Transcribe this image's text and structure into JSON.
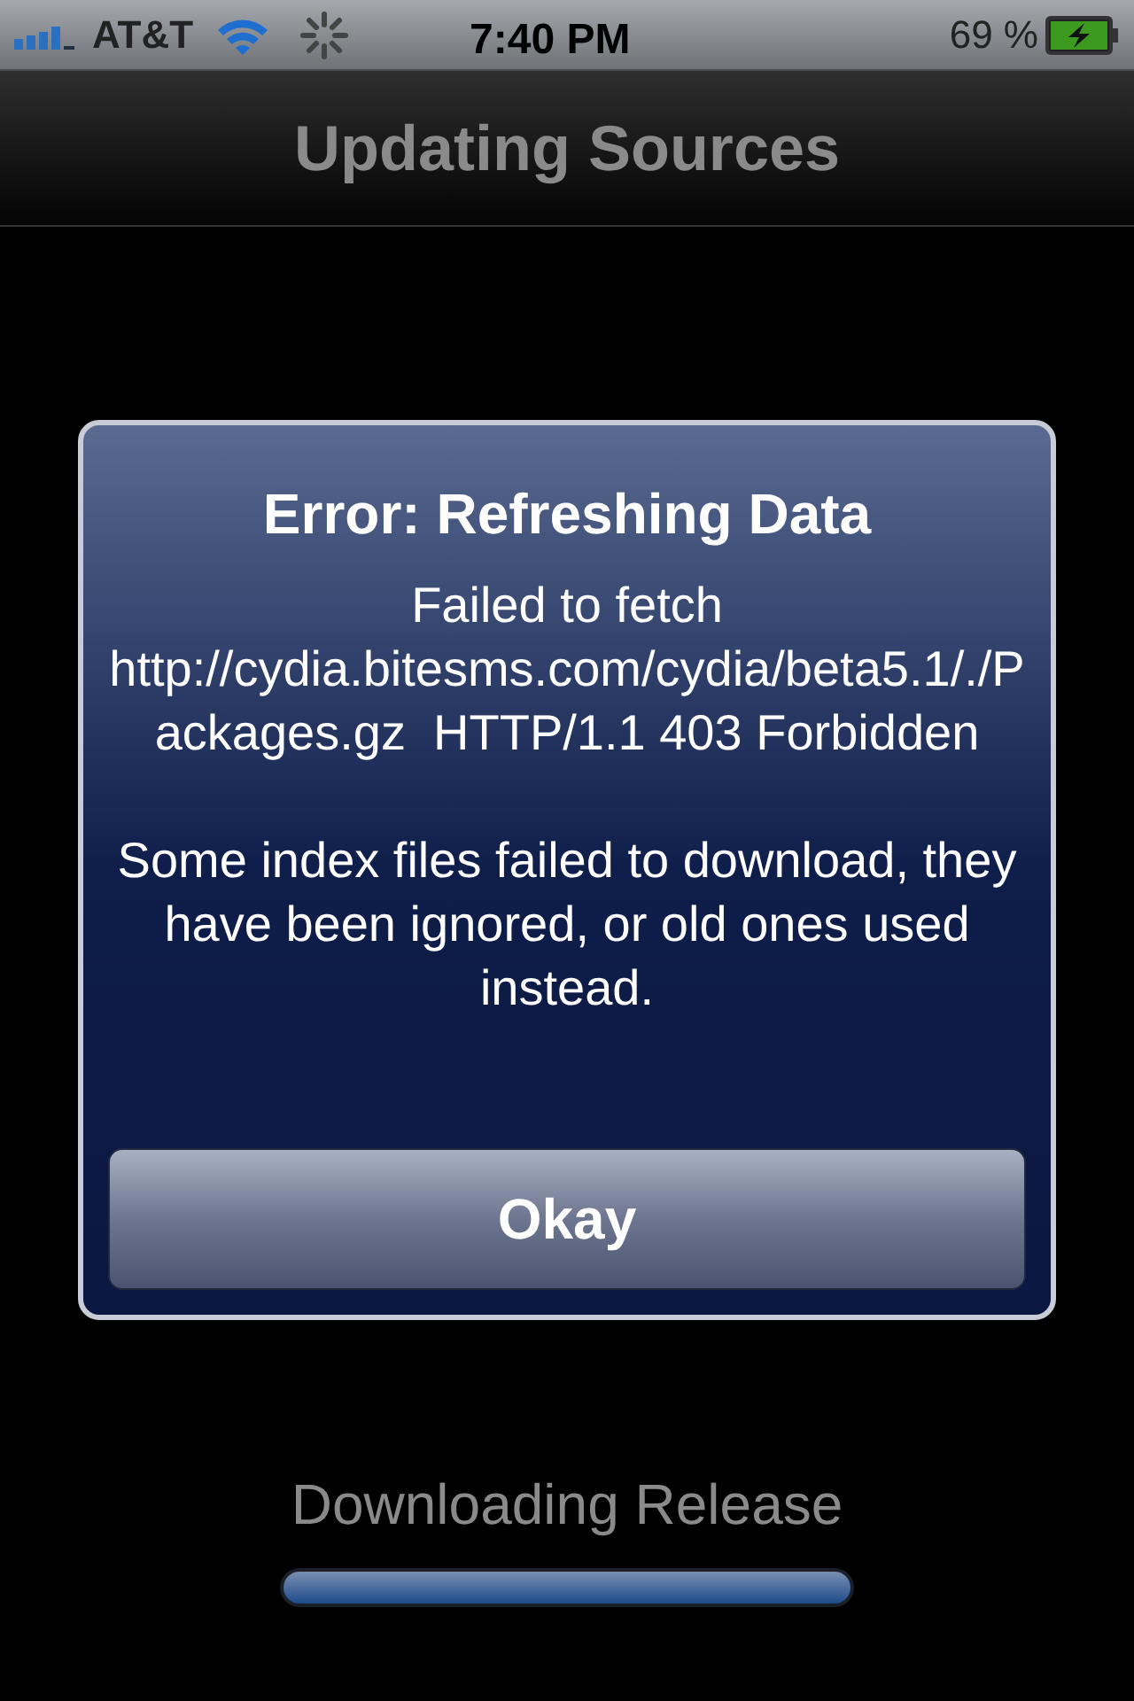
{
  "status_bar": {
    "carrier": "AT&T",
    "time": "7:40 PM",
    "battery": "69 %"
  },
  "nav_bar": {
    "title": "Updating Sources"
  },
  "alert": {
    "title": "Error: Refreshing Data",
    "messages": [
      "Failed to fetch http://cydia.bitesms.com/cydia/beta5.1/./Packages.gz  HTTP/1.1 403 Forbidden",
      "Some index files failed to download, they have been ignored, or old ones used instead."
    ],
    "button": "Okay"
  },
  "progress": {
    "label": "Downloading Release",
    "level": 1
  }
}
